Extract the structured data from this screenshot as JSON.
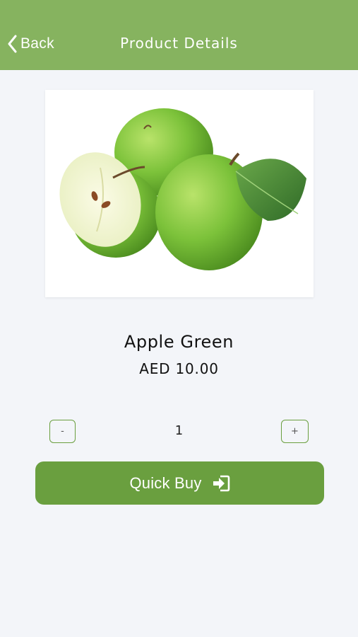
{
  "header": {
    "back_label": "Back",
    "title": "Product Details",
    "background": "#86b35f"
  },
  "product": {
    "image_icon": "green-apples-image",
    "name": "Apple Green",
    "price": "AED 10.00"
  },
  "quantity": {
    "minus_label": "-",
    "value": "1",
    "plus_label": "+"
  },
  "actions": {
    "quick_buy_label": "Quick Buy",
    "quick_buy_icon": "sign-in-icon",
    "button_color": "#6a9f3f"
  }
}
